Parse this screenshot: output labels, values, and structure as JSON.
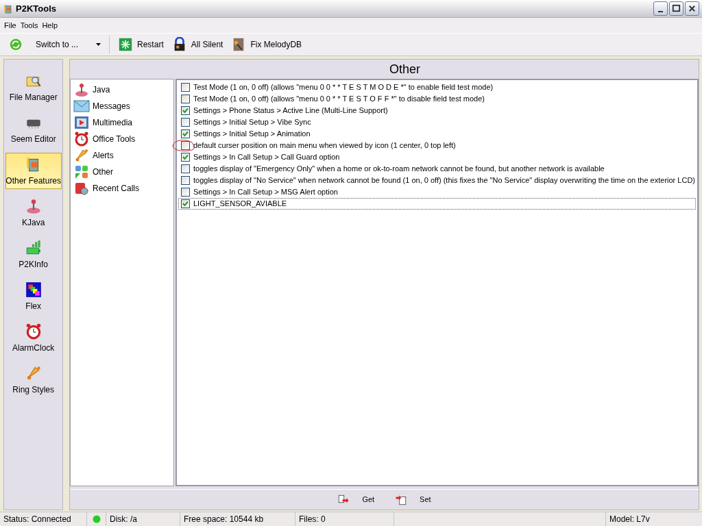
{
  "window": {
    "title": "P2KTools"
  },
  "menu": [
    "File",
    "Tools",
    "Help"
  ],
  "toolbar": [
    {
      "kind": "dropdown",
      "label": "Switch to ..."
    },
    {
      "kind": "button",
      "label": "Restart"
    },
    {
      "kind": "button",
      "label": "All Silent"
    },
    {
      "kind": "button",
      "label": "Fix MelodyDB"
    }
  ],
  "sidebar": {
    "items": [
      {
        "label": "File Manager",
        "selected": false
      },
      {
        "label": "Seem Editor",
        "selected": false
      },
      {
        "label": "Other Features",
        "selected": true
      },
      {
        "label": "KJava",
        "selected": false
      },
      {
        "label": "P2KInfo",
        "selected": false
      },
      {
        "label": "Flex",
        "selected": false
      },
      {
        "label": "AlarmClock",
        "selected": false
      },
      {
        "label": "Ring Styles",
        "selected": false
      }
    ]
  },
  "section_title": "Other",
  "categories": [
    {
      "label": "Java"
    },
    {
      "label": "Messages"
    },
    {
      "label": "Multimedia"
    },
    {
      "label": "Office Tools"
    },
    {
      "label": "Alerts"
    },
    {
      "label": "Other"
    },
    {
      "label": "Recent Calls"
    }
  ],
  "settings": [
    {
      "label": "Test Mode (1 on, 0 off) (allows \"menu 0 0 * * T E S T M O D E *\" to enable field test mode)",
      "checked": false,
      "focused": false
    },
    {
      "label": "Test Mode (1 on, 0 off) (allows \"menu 0 0 * * T E S T O F F *\" to disable field test mode)",
      "checked": false,
      "focused": false
    },
    {
      "label": "Settings > Phone Status > Active Line (Multi-Line Support)",
      "checked": true,
      "focused": false
    },
    {
      "label": "Settings > Initial Setup > Vibe Sync",
      "checked": false,
      "focused": false
    },
    {
      "label": "Settings > Initial Setup > Animation",
      "checked": true,
      "focused": false
    },
    {
      "label": "default curser position on main menu when viewed by icon (1 center, 0 top left)",
      "checked": false,
      "focused": false
    },
    {
      "label": "Settings > In Call Setup > Call Guard option",
      "checked": true,
      "focused": false
    },
    {
      "label": "toggles display of \"Emergency Only\" when a home or ok-to-roam network cannot be found, but another network is available",
      "checked": false,
      "focused": false
    },
    {
      "label": "toggles display of \"No Service\" when network cannot be found (1 on, 0 off) (this fixes the \"No Service\" display overwriting the time on the exterior LCD)",
      "checked": false,
      "focused": false
    },
    {
      "label": "Settings > In Call Setup > MSG Alert option",
      "checked": false,
      "focused": false
    },
    {
      "label": "LIGHT_SENSOR_AVIABLE",
      "checked": true,
      "focused": true
    }
  ],
  "actions": [
    {
      "label": "Get"
    },
    {
      "label": "Set"
    }
  ],
  "status_bar": {
    "status": "Status: Connected",
    "connected": true,
    "disk": "Disk: /a",
    "free_space": "Free space: 10544 kb",
    "files": "Files: 0",
    "model": "Model: L7v"
  }
}
